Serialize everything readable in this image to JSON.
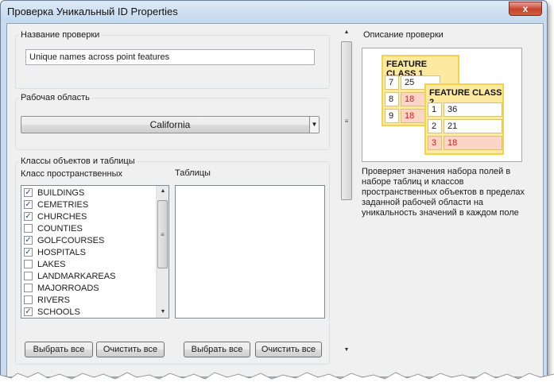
{
  "window": {
    "title": "Проверка Уникальный ID Properties",
    "close_label": "x"
  },
  "check_name": {
    "label": "Название проверки",
    "value": "Unique names across point features"
  },
  "workspace": {
    "label": "Рабочая область",
    "selected": "California"
  },
  "classes": {
    "group_label": "Классы объектов и таблицы",
    "fc_header": "Класс пространственных объектов",
    "tables_header": "Таблицы",
    "items": [
      {
        "label": "BUILDINGS",
        "checked": true
      },
      {
        "label": "CEMETRIES",
        "checked": true
      },
      {
        "label": "CHURCHES",
        "checked": true
      },
      {
        "label": "COUNTIES",
        "checked": false
      },
      {
        "label": "GOLFCOURSES",
        "checked": true
      },
      {
        "label": "HOSPITALS",
        "checked": true
      },
      {
        "label": "LAKES",
        "checked": false
      },
      {
        "label": "LANDMARKAREAS",
        "checked": false
      },
      {
        "label": "MAJORROADS",
        "checked": false
      },
      {
        "label": "RIVERS",
        "checked": false
      },
      {
        "label": "SCHOOLS",
        "checked": true
      }
    ],
    "select_all_label": "Выбрать все",
    "clear_all_label": "Очистить все"
  },
  "description": {
    "label": "Описание проверки",
    "text": "Проверяет значения набора полей в наборе таблиц и классов пространственных объектов в пределах заданной рабочей области на уникальность значений в каждом поле",
    "illustration": {
      "fc1": {
        "title": "FEATURE CLASS 1",
        "rows": [
          [
            "7",
            "25"
          ],
          [
            "8",
            "18"
          ],
          [
            "9",
            "18"
          ]
        ]
      },
      "fc2": {
        "title": "FEATURE CLASS 2",
        "rows": [
          [
            "1",
            "36"
          ],
          [
            "2",
            "21"
          ],
          [
            "3",
            "18"
          ]
        ]
      }
    }
  },
  "colors": {
    "accent_duplicate": "#d02020",
    "fc_fill": "#fdeaa0",
    "fc_border": "#f2d34a",
    "checkmark": "#2a4f8c"
  }
}
